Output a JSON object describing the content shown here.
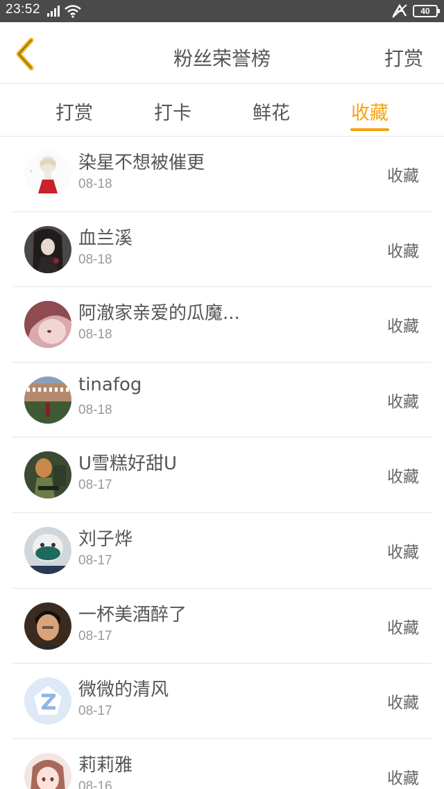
{
  "status_bar": {
    "time": "23:52",
    "network": "4G",
    "battery": "40"
  },
  "header": {
    "title": "粉丝荣誉榜",
    "action_label": "打赏"
  },
  "tabs": [
    {
      "label": "打赏",
      "active": false
    },
    {
      "label": "打卡",
      "active": false
    },
    {
      "label": "鲜花",
      "active": false
    },
    {
      "label": "收藏",
      "active": true
    }
  ],
  "colors": {
    "accent": "#f5a313",
    "text": "#555555",
    "subtext": "#999999",
    "divider": "#e4e4e4",
    "status_bar": "#4a4a4a"
  },
  "fans": [
    {
      "name": "染星不想被催更",
      "date": "08-18",
      "gift": "收藏",
      "avatar": "avatar-girl-red-skirt"
    },
    {
      "name": "血兰溪",
      "date": "08-18",
      "gift": "收藏",
      "avatar": "avatar-dark-anime"
    },
    {
      "name": "阿澈家亲爱的瓜魔...",
      "date": "08-18",
      "gift": "收藏",
      "avatar": "avatar-pink-anime"
    },
    {
      "name": "tinafog",
      "date": "08-18",
      "gift": "收藏",
      "avatar": "avatar-building"
    },
    {
      "name": "U雪糕好甜U",
      "date": "08-17",
      "gift": "收藏",
      "avatar": "avatar-green-figure"
    },
    {
      "name": "刘子烨",
      "date": "08-17",
      "gift": "收藏",
      "avatar": "avatar-masked-face"
    },
    {
      "name": "一杯美酒醉了",
      "date": "08-17",
      "gift": "收藏",
      "avatar": "avatar-man-photo"
    },
    {
      "name": "微微的清风",
      "date": "08-17",
      "gift": "收藏",
      "avatar": "avatar-default-z"
    },
    {
      "name": "莉莉雅",
      "date": "08-16",
      "gift": "收藏",
      "avatar": "avatar-brown-hair-girl"
    }
  ]
}
